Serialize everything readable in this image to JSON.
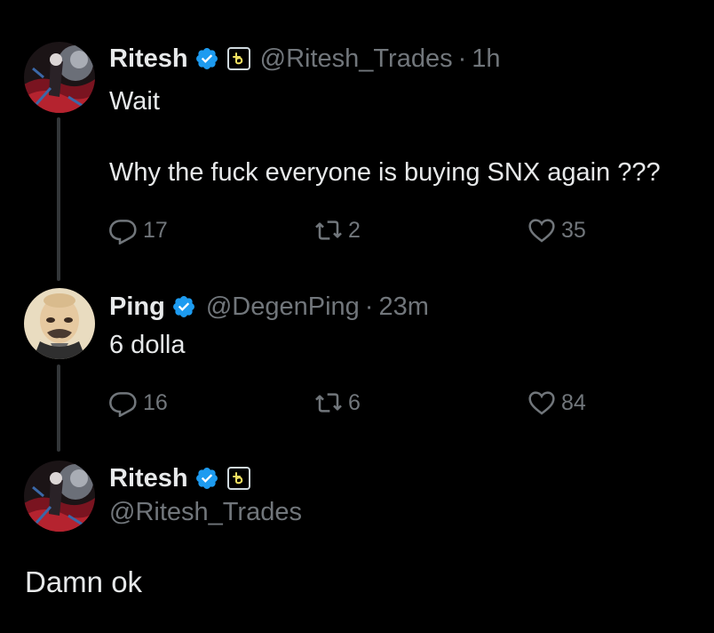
{
  "colors": {
    "background": "#000000",
    "text": "#e7e9ea",
    "muted": "#71767b",
    "verified": "#1d9bf0",
    "thread_line": "#333639"
  },
  "tweets": [
    {
      "name": "Ritesh",
      "handle": "@Ritesh_Trades",
      "separator": "·",
      "time": "1h",
      "verified_icon": "verified-badge-icon",
      "affiliate_icon": "affiliate-badge-icon",
      "text_lines": [
        "Wait",
        "",
        "Why the fuck everyone is buying SNX again ???"
      ],
      "replies": "17",
      "reposts": "2",
      "likes": "35"
    },
    {
      "name": "Ping",
      "handle": "@DegenPing",
      "separator": "·",
      "time": "23m",
      "verified_icon": "verified-badge-icon",
      "text_lines": [
        "6 dolla"
      ],
      "replies": "16",
      "reposts": "6",
      "likes": "84"
    }
  ],
  "main_tweet": {
    "name": "Ritesh",
    "handle": "@Ritesh_Trades",
    "verified_icon": "verified-badge-icon",
    "affiliate_icon": "affiliate-badge-icon",
    "text": "Damn ok"
  }
}
